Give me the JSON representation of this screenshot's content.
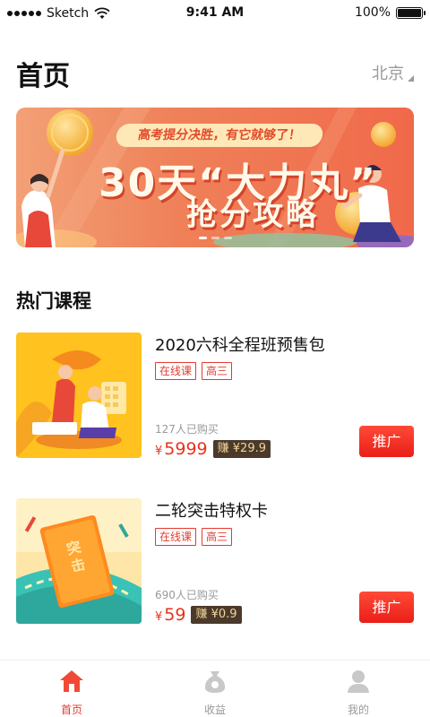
{
  "status_bar": {
    "carrier": "Sketch",
    "time": "9:41 AM",
    "battery": "100%"
  },
  "header": {
    "title": "首页",
    "city": "北京"
  },
  "banner": {
    "subtitle": "高考提分决胜，有它就够了！",
    "headline": "30天“大力丸”",
    "headline2": "抢分攻略",
    "slides": 3,
    "active_slide": 0
  },
  "section": {
    "title": "热门课程"
  },
  "courses": [
    {
      "title": "2020六科全程班预售包",
      "tags": [
        "在线课",
        "高三"
      ],
      "buyers": "127人已购买",
      "currency": "¥",
      "price": "5999",
      "earn": "赚 ¥29.9",
      "action": "推广"
    },
    {
      "title": "二轮突击特权卡",
      "tags": [
        "在线课",
        "高三"
      ],
      "buyers": "690人已购买",
      "currency": "¥",
      "price": "59",
      "earn": "赚 ¥0.9",
      "action": "推广"
    }
  ],
  "tabbar": {
    "items": [
      {
        "label": "首页",
        "icon": "home-icon",
        "active": true
      },
      {
        "label": "收益",
        "icon": "money-bag-icon",
        "active": false
      },
      {
        "label": "我的",
        "icon": "user-icon",
        "active": false
      }
    ]
  },
  "colors": {
    "accent": "#e23b2f",
    "banner": "#f0694a",
    "earn_bg": "#4b3a2b"
  }
}
